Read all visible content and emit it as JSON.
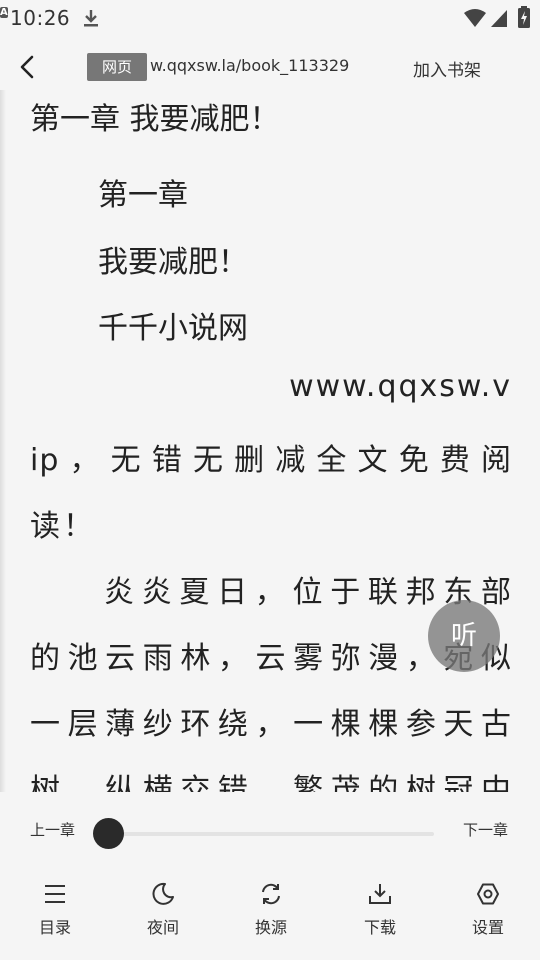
{
  "status_bar": {
    "time": "10:26",
    "a_badge": "A"
  },
  "header": {
    "web_badge": "网页",
    "url": "w.qqxsw.la/book_113329",
    "add_to_shelf": "加入书架"
  },
  "reader": {
    "chapter_title": "第一章 我要减肥！",
    "lines": [
      "第一章",
      "我要减肥！",
      "千千小说网",
      "www.qqxsw.v",
      "ip，无错无删减全文免费阅",
      "读！",
      "炎炎夏日，位于联邦东部",
      "的池云雨林，云雾弥漫，宛似",
      "一层薄纱环绕，一棵棵参天古",
      "树，纵横交错，繁茂的树冠中"
    ],
    "listen_button": "听"
  },
  "chapter_nav": {
    "prev": "上一章",
    "next": "下一章",
    "progress": 0
  },
  "bottom_nav": {
    "items": [
      {
        "label": "目录",
        "icon": "menu-icon"
      },
      {
        "label": "夜间",
        "icon": "moon-icon"
      },
      {
        "label": "换源",
        "icon": "refresh-icon"
      },
      {
        "label": "下载",
        "icon": "download-icon"
      },
      {
        "label": "设置",
        "icon": "settings-icon"
      }
    ]
  },
  "colors": {
    "background": "#f5f5f5",
    "text": "#222222",
    "badge": "#777777",
    "slider_thumb": "#2a2a2a"
  }
}
